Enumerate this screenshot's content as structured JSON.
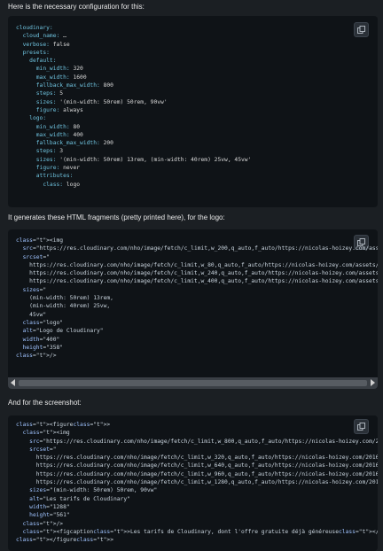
{
  "intro": "Here is the necessary configuration for this:",
  "mid": "It generates these HTML fragments (pretty printed here), for the logo:",
  "last": "And for the screenshot:",
  "config_lines": [
    "cloudinary:",
    "  cloud_name: …",
    "  verbose: false",
    "  presets:",
    "    default:",
    "      min_width: 320",
    "      max_width: 1600",
    "      fallback_max_width: 800",
    "      steps: 5",
    "      sizes: '(min-width: 50rem) 50rem, 90vw'",
    "      figure: always",
    "    logo:",
    "      min_width: 80",
    "      max_width: 400",
    "      fallback_max_width: 200",
    "      steps: 3",
    "      sizes: '(min-width: 50rem) 13rem, (min-width: 40rem) 25vw, 45vw'",
    "      figure: never",
    "      attributes:",
    "        class: logo"
  ],
  "logo_lines": [
    "<img",
    "  src=\"https://res.cloudinary.com/nho/image/fetch/c_limit,w_200,q_auto,f_auto/https://nicolas-hoizey.com/asse",
    "  srcset=\"",
    "    https://res.cloudinary.com/nho/image/fetch/c_limit,w_80,q_auto,f_auto/https://nicolas-hoizey.com/assets/l",
    "    https://res.cloudinary.com/nho/image/fetch/c_limit,w_240,q_auto,f_auto/https://nicolas-hoizey.com/assets/",
    "    https://res.cloudinary.com/nho/image/fetch/c_limit,w_400,q_auto,f_auto/https://nicolas-hoizey.com/assets/",
    "  sizes=\"",
    "    (min-width: 50rem) 13rem,",
    "    (min-width: 40rem) 25vw,",
    "    45vw\"",
    "  class=\"logo\"",
    "  alt=\"Logo de Cloudinary\"",
    "  width=\"400\"",
    "  height=\"358\"",
    "/>"
  ],
  "shot_lines": [
    "<figure>",
    "  <img",
    "    src=\"https://res.cloudinary.com/nho/image/fetch/c_limit,w_800,q_auto,f_auto/https://nicolas-hoizey.com/20",
    "    srcset=\"",
    "      https://res.cloudinary.com/nho/image/fetch/c_limit,w_320,q_auto,f_auto/https://nicolas-hoizey.com/2016/",
    "      https://res.cloudinary.com/nho/image/fetch/c_limit,w_640,q_auto,f_auto/https://nicolas-hoizey.com/2016/",
    "      https://res.cloudinary.com/nho/image/fetch/c_limit,w_960,q_auto,f_auto/https://nicolas-hoizey.com/2016/",
    "      https://res.cloudinary.com/nho/image/fetch/c_limit,w_1280,q_auto,f_auto/https://nicolas-hoizey.com/2016",
    "    sizes=\"(min-width: 50rem) 50rem, 90vw\"",
    "    alt=\"Les tarifs de Cloudinary\"",
    "    width=\"1288\"",
    "    height=\"561\"",
    "  />",
    "  <figcaption>Les tarifs de Cloudinary, dont l'offre gratuite déjà généreuse</figcaption>",
    "</figure>"
  ],
  "colors": {
    "background": "#1b1f23",
    "code_bg": "#0f1317",
    "key": "#6fc3df",
    "tag": "#7ec6ee",
    "attr": "#9fc3ff"
  }
}
